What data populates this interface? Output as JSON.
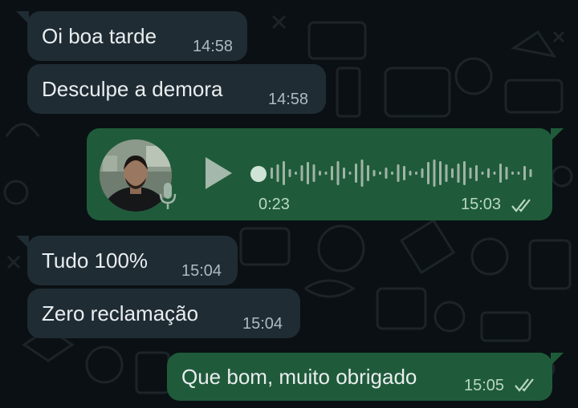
{
  "colors": {
    "background": "#0b1014",
    "incoming_bubble": "#1f2c33",
    "outgoing_bubble": "#1f5b3a",
    "text": "#e9edef",
    "meta_text_in": "#aebac1",
    "meta_text_out": "#b9d7c4"
  },
  "messages": [
    {
      "direction": "incoming",
      "type": "text",
      "text": "Oi boa tarde",
      "time": "14:58"
    },
    {
      "direction": "incoming",
      "type": "text",
      "text": "Desculpe a demora",
      "time": "14:58"
    },
    {
      "direction": "outgoing",
      "type": "voice",
      "duration": "0:23",
      "time": "15:03",
      "status": "read",
      "status_icon": "double-check-icon",
      "play_icon": "play-icon",
      "mic_icon": "microphone-icon"
    },
    {
      "direction": "incoming",
      "type": "text",
      "text": "Tudo 100%",
      "time": "15:04"
    },
    {
      "direction": "incoming",
      "type": "text",
      "text": "Zero reclamação",
      "time": "15:04"
    },
    {
      "direction": "outgoing",
      "type": "text",
      "text": "Que bom, muito obrigado",
      "time": "15:05",
      "status": "read",
      "status_icon": "double-check-icon"
    }
  ]
}
